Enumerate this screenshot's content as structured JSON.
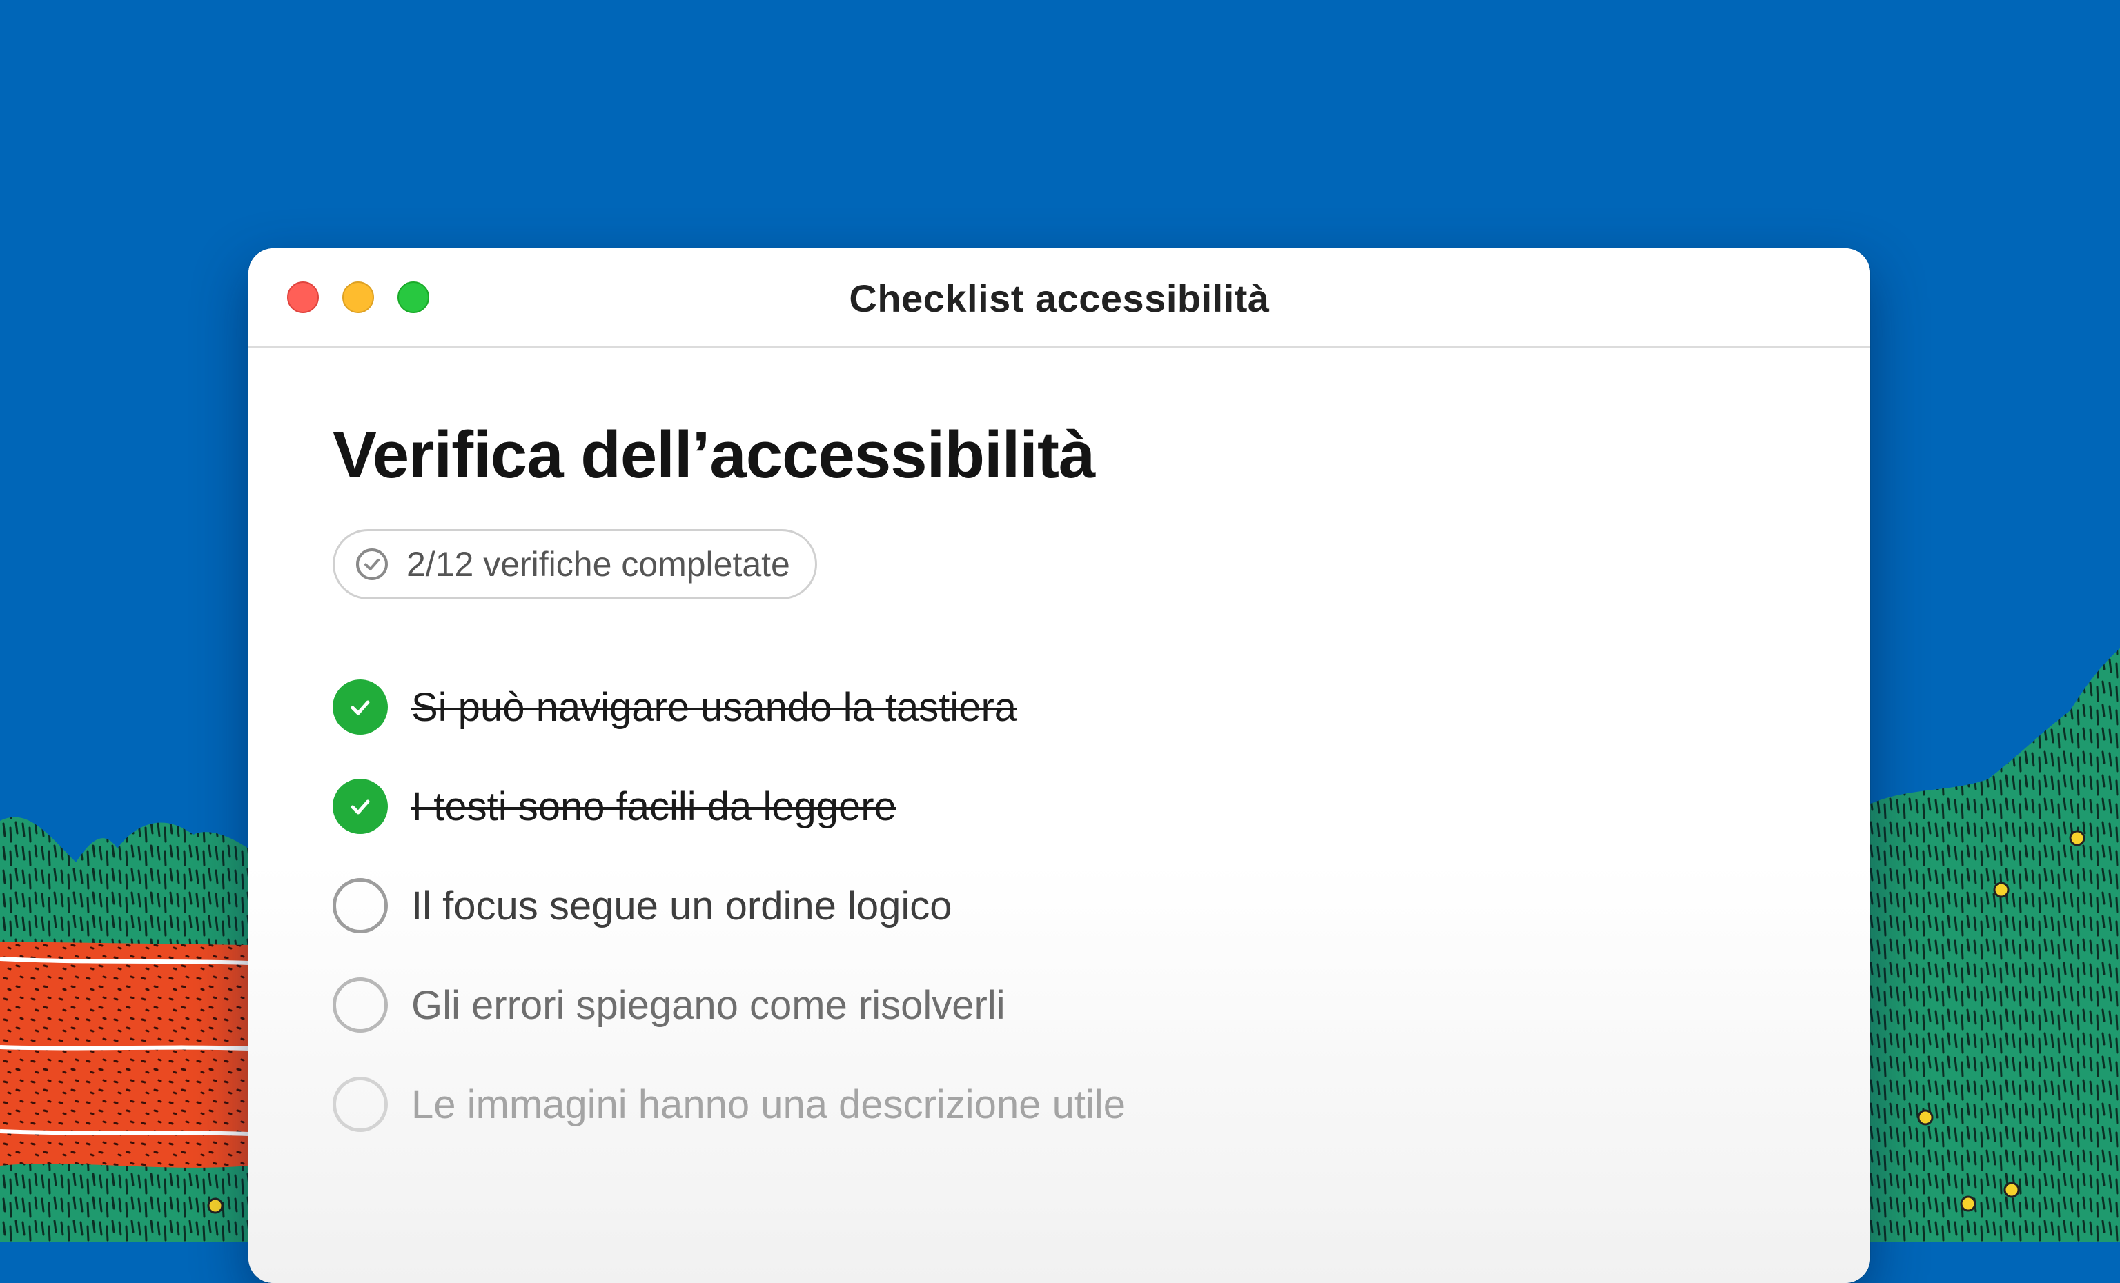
{
  "window": {
    "title": "Checklist accessibilità"
  },
  "page": {
    "title": "Verifica dell’accessibilità",
    "progress": {
      "label": "2/12 verifiche completate",
      "completed": 2,
      "total": 12,
      "icon": "check-circle-icon"
    }
  },
  "checklist": {
    "items": [
      {
        "label": "Si può navigare usando la tastiera",
        "checked": true
      },
      {
        "label": "I testi sono facili da leggere",
        "checked": true
      },
      {
        "label": "Il focus segue un ordine logico",
        "checked": false
      },
      {
        "label": "Gli errori spiegano come risolverli",
        "checked": false
      },
      {
        "label": "Le immagini hanno una descrizione utile",
        "checked": false
      }
    ]
  },
  "colors": {
    "desktop_background": "#0066b8",
    "checked_green": "#21ad3a",
    "close_button": "#ff5f57",
    "minimize_button": "#febc2e",
    "zoom_button": "#28c840"
  }
}
